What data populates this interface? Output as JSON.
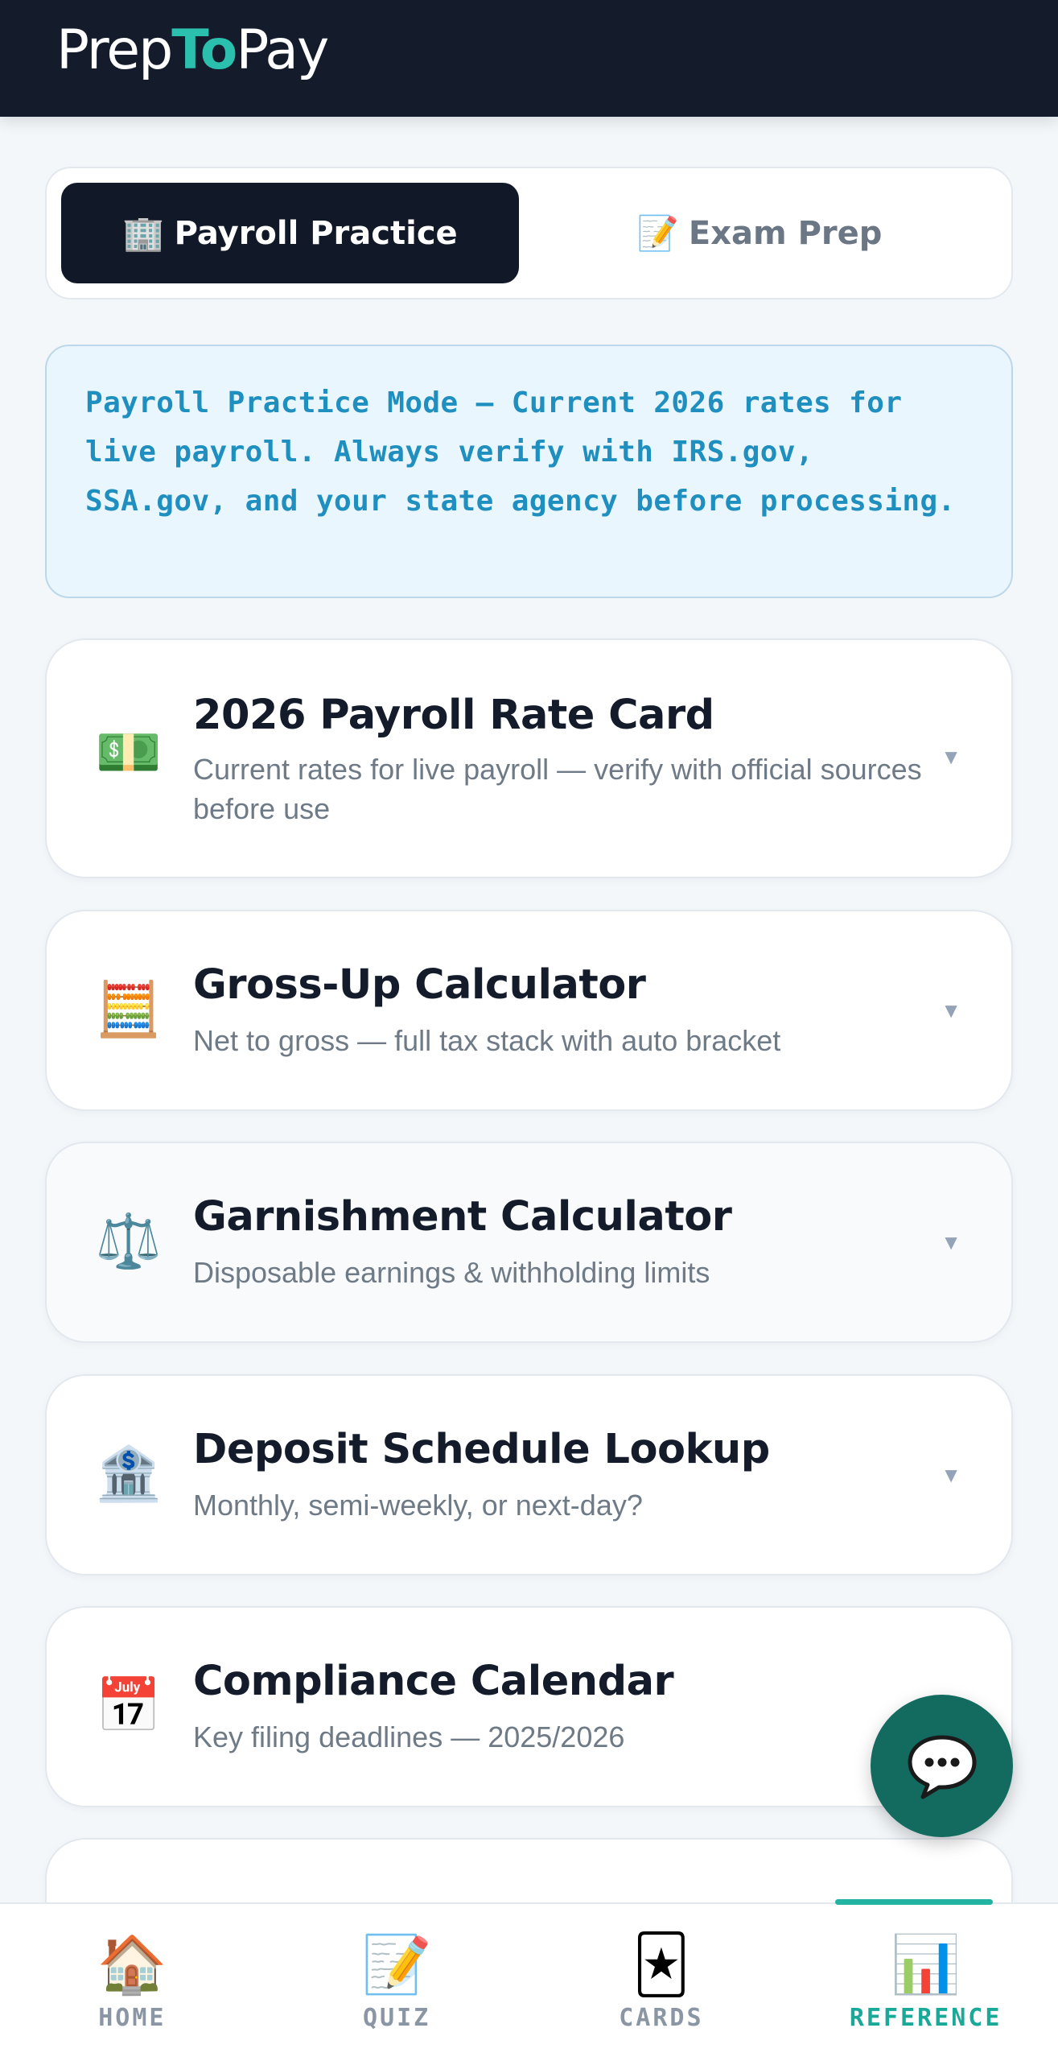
{
  "app": {
    "logo_prefix": "Prep",
    "logo_accent": "To",
    "logo_suffix": "Pay"
  },
  "mode_toggle": {
    "active_emoji": "🏢",
    "active_label": "Payroll Practice",
    "inactive_emoji": "📝",
    "inactive_label": "Exam Prep"
  },
  "notice": {
    "text": "Payroll Practice Mode — Current 2026 rates for live payroll. Always verify with IRS.gov, SSA.gov, and your state agency before processing."
  },
  "cards": [
    {
      "emoji": "💵",
      "title": "2026 Payroll Rate Card",
      "subtitle": "Current rates for live payroll — verify with official sources before use",
      "chevron": "▼"
    },
    {
      "emoji": "🧮",
      "title": "Gross-Up Calculator",
      "subtitle": "Net to gross — full tax stack with auto bracket",
      "chevron": "▼"
    },
    {
      "emoji": "⚖️",
      "title": "Garnishment Calculator",
      "subtitle": "Disposable earnings & withholding limits",
      "chevron": "▼"
    },
    {
      "emoji": "🏦",
      "title": "Deposit Schedule Lookup",
      "subtitle": "Monthly, semi-weekly, or next-day?",
      "chevron": "▼"
    },
    {
      "emoji": "📅",
      "title": "Compliance Calendar",
      "subtitle": "Key filing deadlines — 2025/2026"
    }
  ],
  "chat": {
    "emoji": "💬"
  },
  "bottom_nav": [
    {
      "emoji": "🏠",
      "label": "HOME"
    },
    {
      "emoji": "📝",
      "label": "QUIZ"
    },
    {
      "emoji": "🃏",
      "label": "CARDS"
    },
    {
      "emoji": "📊",
      "label": "REFERENCE",
      "active": true
    }
  ],
  "colors": {
    "header_bg": "#141c2b",
    "accent_teal": "#2bbfae",
    "notice_text": "#1f8fbf",
    "fab_bg": "#136b60"
  }
}
